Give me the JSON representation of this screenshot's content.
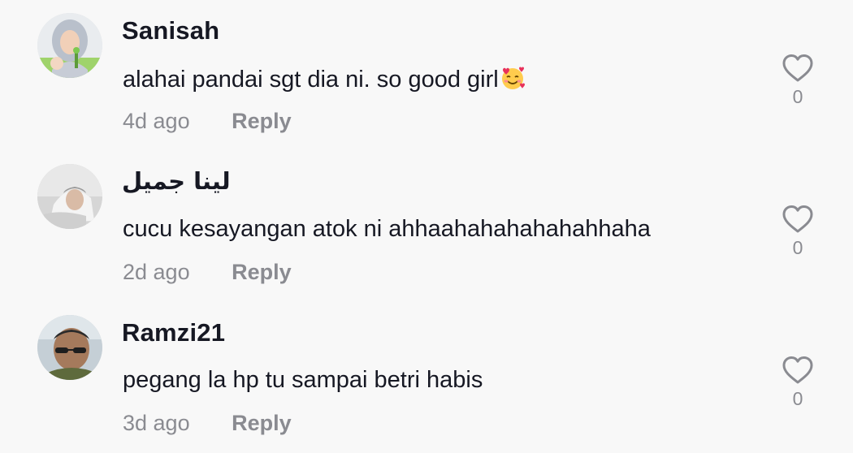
{
  "comments": [
    {
      "username": "Sanisah",
      "text": "alahai pandai sgt dia ni. so good girl",
      "emoji": "smiling-face-with-hearts-emoji",
      "time": "4d ago",
      "reply_label": "Reply",
      "like_count": "0"
    },
    {
      "username": "لينا جميل",
      "text": "cucu kesayangan atok ni ahhaahahahahahahhaha",
      "time": "2d ago",
      "reply_label": "Reply",
      "like_count": "0"
    },
    {
      "username": "Ramzi21",
      "text": "pegang la hp tu sampai betri habis",
      "time": "3d ago",
      "reply_label": "Reply",
      "like_count": "0"
    }
  ],
  "icons": {
    "like": "heart-outline-icon"
  },
  "colors": {
    "background": "#f8f8f8",
    "primary_text": "#161823",
    "secondary_text": "#8a8b91"
  }
}
